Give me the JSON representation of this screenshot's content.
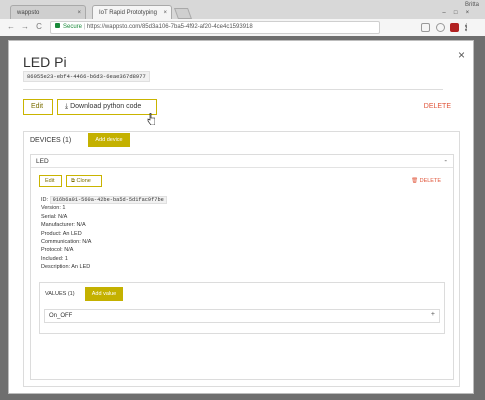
{
  "browser": {
    "tabs": [
      {
        "label": "wappsto"
      },
      {
        "label": "IoT Rapid Prototyping"
      }
    ],
    "user": "Britta",
    "window_controls": [
      "–",
      "□",
      "×"
    ],
    "address": {
      "secure_label": "Secure",
      "url": "https://wappsto.com/85d3a106-7ba5-4f92-af20-4ce4c1593918"
    },
    "nav": {
      "back": "←",
      "forward": "→",
      "reload": "C"
    }
  },
  "modal": {
    "close": "×",
    "title": "LED Pi",
    "uuid": "86055e23-ebf4-4466-b6d3-6eae367d8977",
    "edit_label": "Edit",
    "download_label": "Download python code",
    "delete_label": "DELETE",
    "devices": {
      "header": "DEVICES (1)",
      "add_device_label": "Add device",
      "device": {
        "name": "LED",
        "toggle": "-",
        "edit_label": "Edit",
        "clone_label": "Clone",
        "delete_label": "DELETE",
        "props": {
          "id_label": "ID:",
          "id_value": "916b6a01-560a-42be-ba5d-5d1fac9f7be",
          "version": "Version: 1",
          "serial": "Serial: N/A",
          "manufacturer": "Manufacturer: N/A",
          "product": "Product: An LED",
          "communication": "Communication: N/A",
          "protocol": "Protocol: N/A",
          "included": "Included: 1",
          "description": "Description: An LED"
        },
        "values": {
          "header": "VALUES (1)",
          "add_value_label": "Add value",
          "items": [
            {
              "name": "On_OFF",
              "toggle": "+"
            }
          ]
        }
      }
    }
  },
  "colors": {
    "accent": "#c4b100",
    "delete": "#e0553a",
    "secure": "#1a8a3a"
  }
}
